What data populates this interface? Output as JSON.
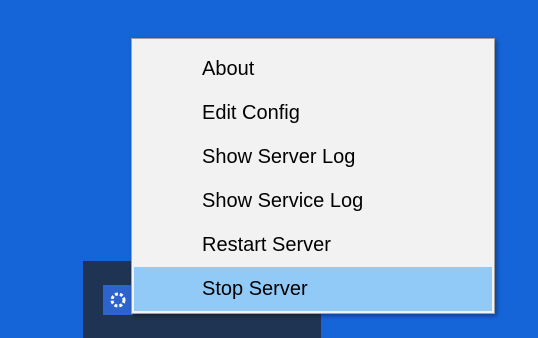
{
  "menu": {
    "items": [
      {
        "label": "About"
      },
      {
        "label": "Edit Config"
      },
      {
        "label": "Show Server Log"
      },
      {
        "label": "Show Service Log"
      },
      {
        "label": "Restart Server"
      },
      {
        "label": "Stop Server",
        "highlighted": true
      }
    ]
  },
  "tray": {
    "icon": "server-app-icon"
  },
  "colors": {
    "desktop": "#1565d8",
    "taskbar": "#1f3352",
    "menu_background": "#f2f2f2",
    "highlight": "#91c9f7"
  }
}
